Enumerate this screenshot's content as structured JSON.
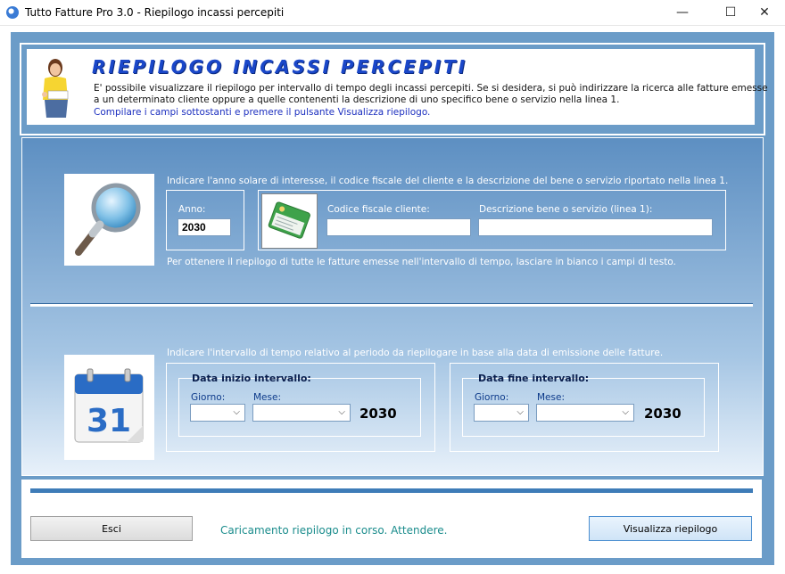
{
  "window": {
    "title": "Tutto Fatture Pro 3.0 - Riepilogo incassi percepiti",
    "minimize": "—",
    "maximize": "☐",
    "close": "✕"
  },
  "header": {
    "title": "RIEPILOGO INCASSI PERCEPITI",
    "line1": "E' possibile visualizzare il riepilogo per intervallo di tempo degli incassi percepiti. Se si desidera, si può indirizzare la ricerca alle fatture emesse",
    "line2": "a un determinato cliente oppure a quelle contenenti la descrizione di uno specifico bene o servizio nella linea 1.",
    "line3": "Compilare i campi sottostanti e premere il pulsante Visualizza riepilogo."
  },
  "search": {
    "hint_top": "Indicare l'anno solare di interesse, il codice fiscale del cliente e la descrizione del bene o servizio riportato nella linea 1.",
    "anno_label": "Anno:",
    "anno_value": "2030",
    "cf_label": "Codice fiscale cliente:",
    "cf_value": "",
    "desc_label": "Descrizione bene o servizio (linea 1):",
    "desc_value": "",
    "hint_bottom": "Per ottenere il riepilogo di tutte le fatture emesse nell'intervallo di tempo, lasciare in bianco i campi di testo."
  },
  "interval": {
    "hint": "Indicare l'intervallo di tempo relativo al periodo da riepilogare in base alla data di emissione delle fatture.",
    "calendar_day": "31",
    "start": {
      "legend": "Data inizio intervallo:",
      "giorno_label": "Giorno:",
      "mese_label": "Mese:",
      "giorno_value": "",
      "mese_value": "",
      "year": "2030"
    },
    "end": {
      "legend": "Data fine intervallo:",
      "giorno_label": "Giorno:",
      "mese_label": "Mese:",
      "giorno_value": "",
      "mese_value": "",
      "year": "2030"
    }
  },
  "footer": {
    "exit_label": "Esci",
    "status": "Caricamento riepilogo in corso. Attendere.",
    "view_label": "Visualizza riepilogo"
  },
  "colors": {
    "frame": "#6b9cc8",
    "title_blue": "#1a47c9",
    "status_teal": "#1a8c8c"
  }
}
